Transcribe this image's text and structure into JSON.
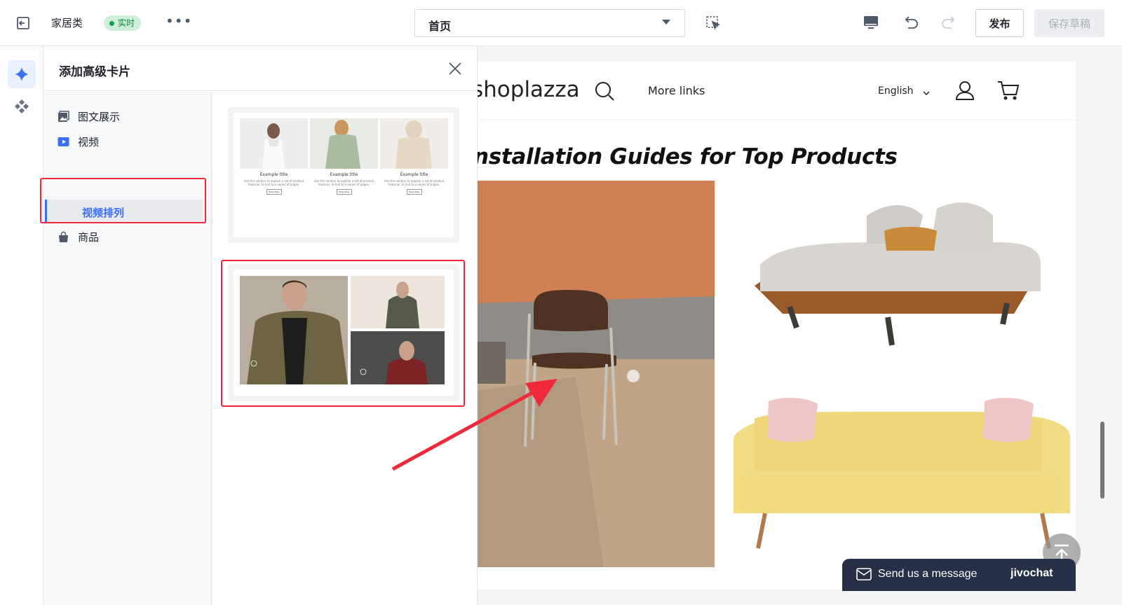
{
  "topbar": {
    "store_name": "家居类",
    "live_badge": "实时",
    "more": "•••",
    "page_select": "首页",
    "publish": "发布",
    "save_draft": "保存草稿"
  },
  "panel": {
    "title": "添加高级卡片",
    "categories": [
      {
        "label": "图文展示",
        "icon": "image-icon"
      },
      {
        "label": "视频",
        "icon": "video-icon"
      },
      {
        "label": "视频排列",
        "icon": ""
      },
      {
        "label": "商品",
        "icon": "bag-icon"
      }
    ],
    "template1": {
      "cards": [
        {
          "title": "Example title",
          "desc": "Use this section to explain a set of product features, to link to a series of pages.",
          "button": "Shop Now"
        },
        {
          "title": "Example title",
          "desc": "Use this section to explain a set of product features, to link to a series of pages.",
          "button": "Shop Now"
        },
        {
          "title": "Example title",
          "desc": "Use this section to explain a set of product features, to link to a series of pages.",
          "button": "Shop Now"
        }
      ]
    }
  },
  "preview": {
    "logo": "shoplazza",
    "nav_link": "More links",
    "language": "English",
    "heading": "nstallation Guides for Top Products"
  },
  "chat": {
    "message": "Send us a message",
    "brand": "jivochat"
  },
  "colors": {
    "accent": "#3b6ff5",
    "highlight": "#ee2a3a",
    "live_bg": "#cdeed9",
    "chat_bg": "#263148"
  }
}
